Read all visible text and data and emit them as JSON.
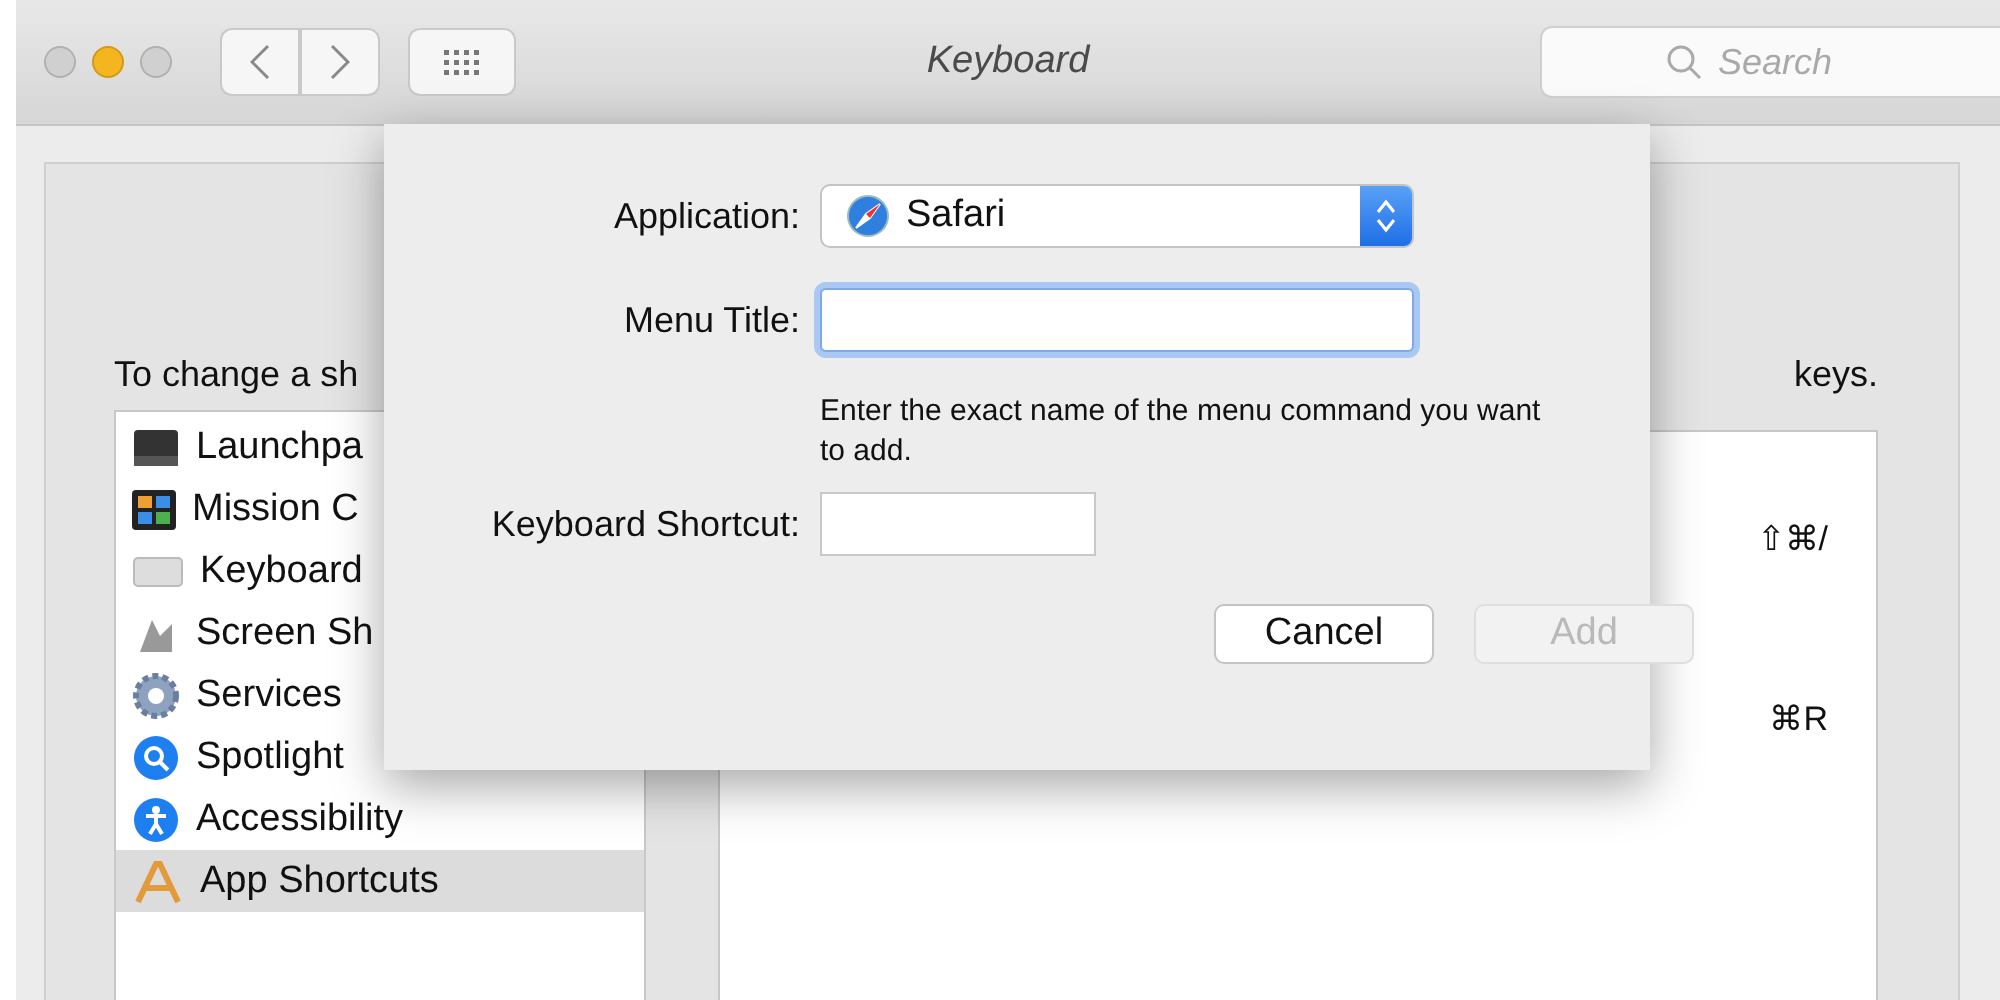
{
  "window": {
    "title": "Keyboard"
  },
  "search": {
    "placeholder": "Search"
  },
  "pane": {
    "instruction": "To change a sh",
    "instruction_end": "keys.",
    "categories": [
      {
        "label": "Launchpa",
        "selected": false
      },
      {
        "label": "Mission C",
        "selected": false
      },
      {
        "label": "Keyboard",
        "selected": false
      },
      {
        "label": "Screen Sh",
        "selected": false
      },
      {
        "label": "Services",
        "selected": false
      },
      {
        "label": "Spotlight",
        "selected": false
      },
      {
        "label": "Accessibility",
        "selected": false
      },
      {
        "label": "App Shortcuts",
        "selected": true
      }
    ],
    "shortcuts": [
      {
        "keys": "⇧⌘/"
      },
      {
        "keys": "⌘R"
      }
    ]
  },
  "dialog": {
    "application_label": "Application:",
    "application_value": "Safari",
    "menu_title_label": "Menu Title:",
    "menu_title_focused": true,
    "hint": "Enter the exact name of the menu command you want to add.",
    "shortcut_label": "Keyboard Shortcut:",
    "buttons": [
      {
        "label": "Cancel",
        "disabled": false
      },
      {
        "label": "Add",
        "disabled": true
      }
    ]
  }
}
